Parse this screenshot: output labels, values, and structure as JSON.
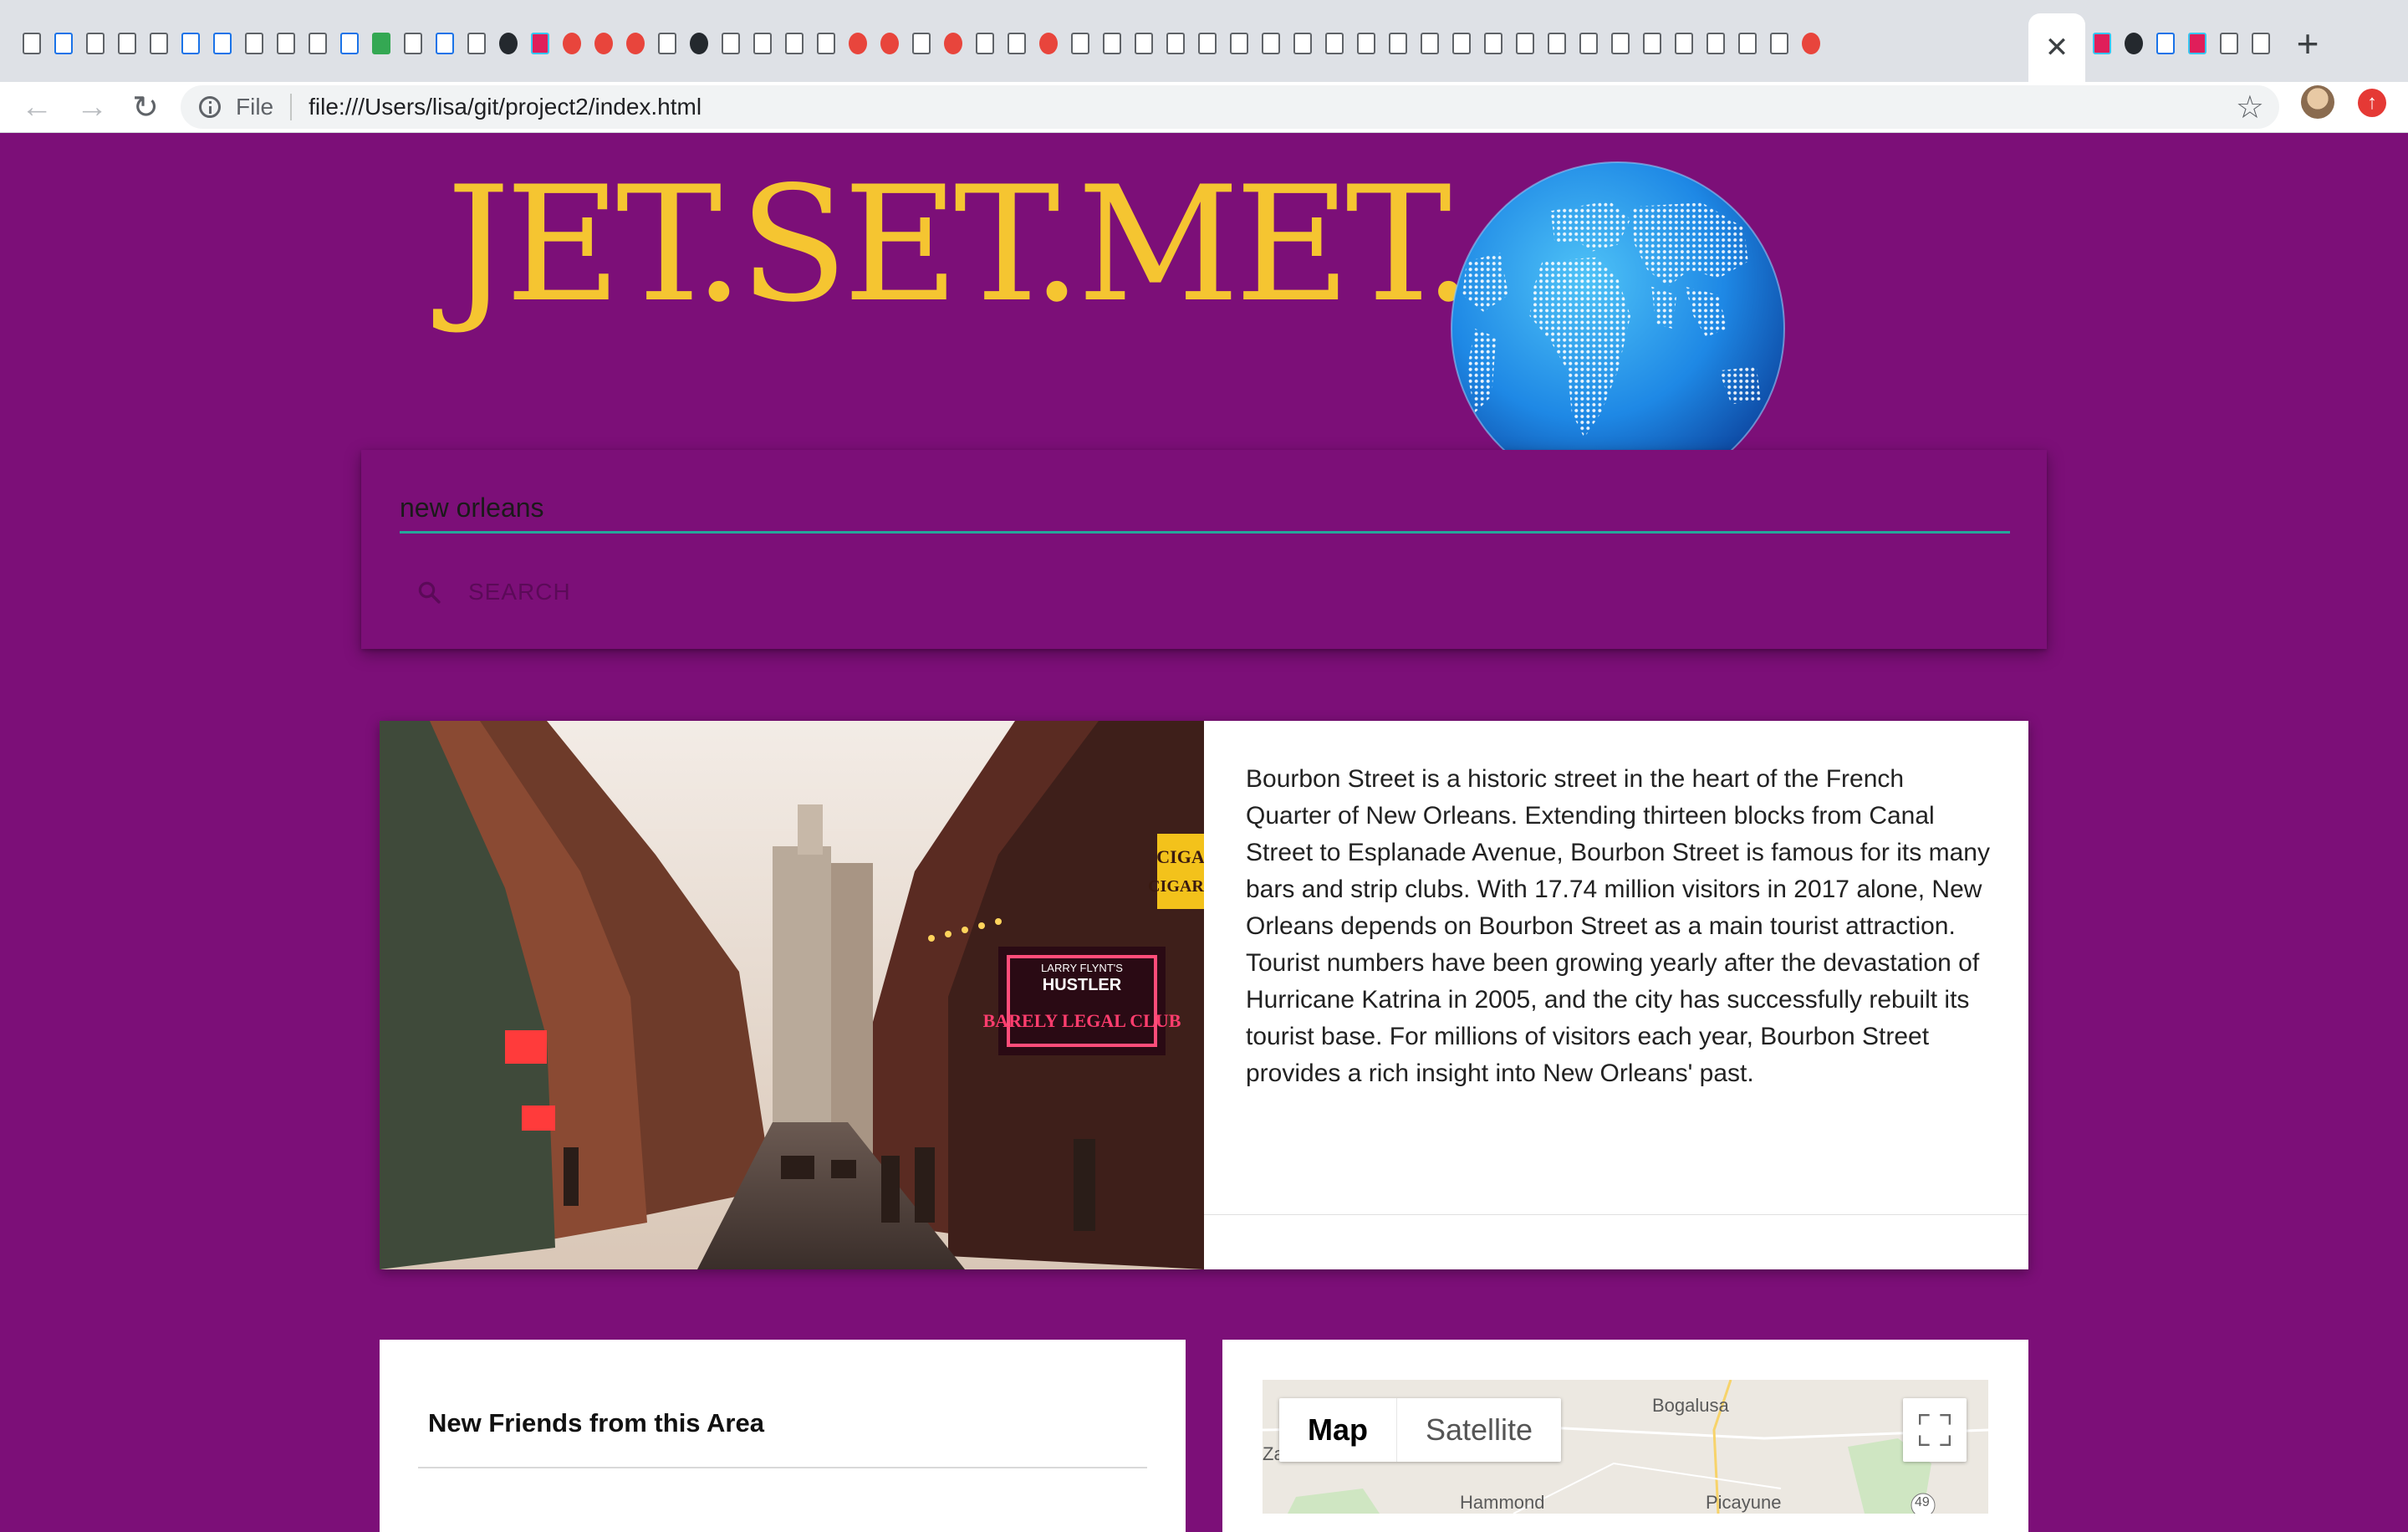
{
  "browser": {
    "active_tab_close_glyph": "✕",
    "new_tab_glyph": "+",
    "scheme_label": "File",
    "url": "file:///Users/lisa/git/project2/index.html",
    "update_glyph": "↑",
    "nav": {
      "back_glyph": "←",
      "forward_glyph": "→",
      "reload_glyph": "↻",
      "star_glyph": "☆"
    }
  },
  "header": {
    "logo_text": "JET.SET.MET."
  },
  "search": {
    "value": "new orleans",
    "button_label": "SEARCH"
  },
  "info": {
    "description": "Bourbon Street is a historic street in the heart of the French Quarter of New Orleans. Extending thirteen blocks from Canal Street to Esplanade Avenue, Bourbon Street is famous for its many bars and strip clubs. With 17.74 million visitors in 2017 alone, New Orleans depends on Bourbon Street as a main tourist attraction. Tourist numbers have been growing yearly after the devastation of Hurricane Katrina in 2005, and the city has successfully rebuilt its tourist base. For millions of visitors each year, Bourbon Street provides a rich insight into New Orleans' past.",
    "photo_signs": {
      "sign_top": "LARRY FLYNT'S",
      "sign_mid": "HUSTLER",
      "sign_main": "BARELY LEGAL CLUB",
      "sign_cigar_1": "CIGA",
      "sign_cigar_2": "CIGARS"
    }
  },
  "friends": {
    "title": "New Friends from this Area"
  },
  "map": {
    "map_button": "Map",
    "satellite_button": "Satellite",
    "places": [
      "Bogalusa",
      "Za",
      "Hammond",
      "Picayune",
      "49"
    ]
  },
  "colors": {
    "page_bg": "#7c0f78",
    "logo": "#f5c531",
    "input_underline": "#26a69a",
    "globe": "#1e88e5"
  }
}
